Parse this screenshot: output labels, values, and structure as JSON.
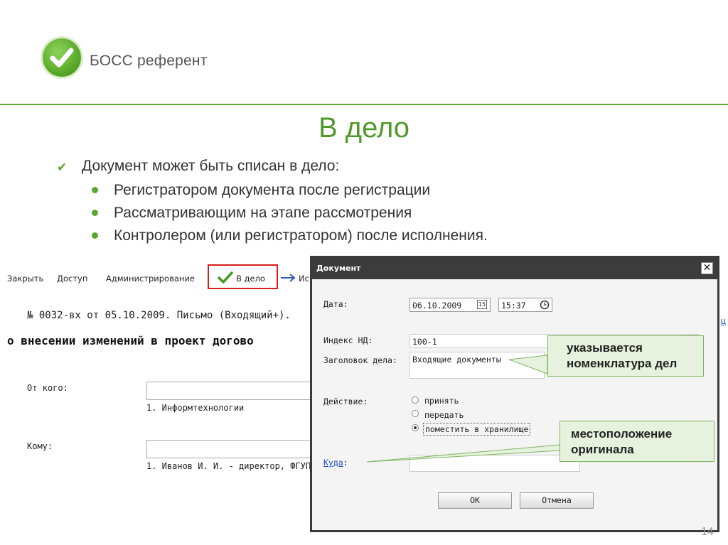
{
  "logo": {
    "text": "БОСС референт"
  },
  "slide": {
    "title": "В дело",
    "main_bullet": "Документ может быть списан в дело:",
    "sub_bullets": [
      "Регистратором документа после регистрации",
      "Рассматривающим на этапе рассмотрения",
      "Контролером (или регистратором) после исполнения."
    ],
    "page_number": "14"
  },
  "toolbar": {
    "items": [
      "Закрыть",
      "Доступ",
      "Администрирование",
      "В дело",
      "Ис"
    ]
  },
  "document": {
    "number_line": "№ 0032-вх от 05.10.2009. Письмо (Входящий+).",
    "subject": "о внесении изменений в проект догово",
    "from_label": "От кого:",
    "from_value": "1. Информтехнологии",
    "to_label": "Кому:",
    "to_value": "1. Иванов И. И. - директор, ФГУП (",
    "right_edge_text": "ц"
  },
  "dialog": {
    "title": "Документ",
    "close": "✕",
    "date_label": "Дата:",
    "date_value": "06.10.2009",
    "calendar_badge": "15",
    "time_value": "15:37",
    "index_label": "Индекс НД:",
    "index_value": "100-1",
    "case_title_label": "Заголовок дела:",
    "case_title_value": "Входящие документы",
    "action_label": "Действие:",
    "actions": [
      {
        "label": "принять",
        "selected": false
      },
      {
        "label": "передать",
        "selected": false
      },
      {
        "label": "поместить в хранилище",
        "selected": true
      }
    ],
    "where_label": "Куда",
    "where_suffix": ":",
    "ok_label": "OK",
    "cancel_label": "Отмена"
  },
  "callouts": {
    "nomenclature": [
      "указывается",
      "номенклатура дел"
    ],
    "location": [
      "местоположение",
      "оригинала"
    ]
  },
  "colors": {
    "accent_green": "#5aa832",
    "title_green": "#4f9a2a",
    "highlight_red": "#d81e1e",
    "callout_bg": "#e6f2dd",
    "link_blue": "#1a4fc4"
  }
}
